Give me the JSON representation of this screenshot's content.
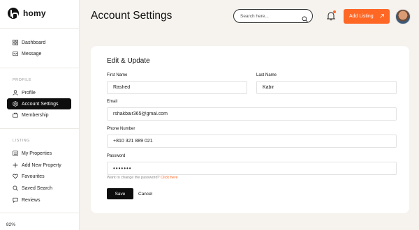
{
  "brand": {
    "name": "homy"
  },
  "sidebar": {
    "main_items": [
      {
        "label": "Dashboard",
        "icon": "dashboard-icon"
      },
      {
        "label": "Message",
        "icon": "message-icon"
      }
    ],
    "profile_section": "PROFILE",
    "profile_items": [
      {
        "label": "Profile",
        "icon": "user-icon"
      },
      {
        "label": "Account Settings",
        "icon": "settings-icon",
        "active": true
      },
      {
        "label": "Membership",
        "icon": "membership-icon"
      }
    ],
    "listing_section": "LISTING",
    "listing_items": [
      {
        "label": "My Properties",
        "icon": "properties-icon"
      },
      {
        "label": "Add New Property",
        "icon": "plus-icon"
      },
      {
        "label": "Favourites",
        "icon": "heart-icon"
      },
      {
        "label": "Saved Search",
        "icon": "search-icon"
      },
      {
        "label": "Reviews",
        "icon": "chat-icon"
      }
    ],
    "zoom": "82%"
  },
  "header": {
    "title": "Account Settings",
    "search_placeholder": "Search here...",
    "add_listing_label": "Add Listing"
  },
  "form": {
    "title": "Edit & Update",
    "first_name_label": "First Name",
    "first_name_value": "Rashed",
    "last_name_label": "Last Name",
    "last_name_value": "Kabir",
    "email_label": "Email",
    "email_value": "rshakbair365@gmal.com",
    "phone_label": "Phone Number",
    "phone_value": "+810 321 889 021",
    "password_label": "Password",
    "password_value": "•••••••",
    "hint_text": "Want to change the password?",
    "hint_link": "Click here",
    "save_label": "Save",
    "cancel_label": "Cancel"
  },
  "colors": {
    "accent": "#ff6725",
    "dark": "#0e0e0e",
    "background": "#f6f2ee"
  }
}
